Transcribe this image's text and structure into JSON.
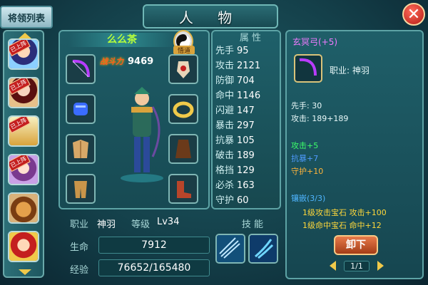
{
  "header": {
    "title": "人 物",
    "list_tab": "将领列表",
    "close_symbol": "✕"
  },
  "roster": {
    "items": [
      {
        "locked": true,
        "locked_label": "已上阵"
      },
      {
        "locked": true,
        "locked_label": "已上阵"
      },
      {
        "locked": true,
        "locked_label": "已上阵"
      },
      {
        "locked": true,
        "locked_label": "已上阵"
      },
      {
        "locked": false,
        "locked_label": ""
      },
      {
        "locked": false,
        "locked_label": ""
      }
    ]
  },
  "hero": {
    "name": "么么茶",
    "seal_label": "悟道",
    "power_label": "战斗力",
    "power_value": "9469",
    "profession_label": "职业",
    "profession_value": "神羽",
    "level_label": "等级",
    "level_value": "Lv34",
    "hp_label": "生命",
    "hp_value": "7912",
    "exp_label": "经验",
    "exp_value": "76652/165480"
  },
  "attributes": {
    "title": "属 性",
    "rows": [
      {
        "k": "先手",
        "v": "95"
      },
      {
        "k": "攻击",
        "v": "2121"
      },
      {
        "k": "防御",
        "v": "704"
      },
      {
        "k": "命中",
        "v": "1146"
      },
      {
        "k": "闪避",
        "v": "147"
      },
      {
        "k": "暴击",
        "v": "297"
      },
      {
        "k": "抗暴",
        "v": "105"
      },
      {
        "k": "破击",
        "v": "189"
      },
      {
        "k": "格挡",
        "v": "129"
      },
      {
        "k": "必杀",
        "v": "163"
      },
      {
        "k": "守护",
        "v": "60"
      }
    ]
  },
  "skills": {
    "title": "技 能"
  },
  "detail": {
    "item_name": "玄冥弓(+5)",
    "job_line": "职业: 神羽",
    "speed_line": "先手:    30",
    "attack_line": "攻击:    189+189",
    "bonuses": [
      {
        "text": "攻击+5",
        "color": "#3dff6a"
      },
      {
        "text": "抗暴+7",
        "color": "#4f9bff"
      },
      {
        "text": "守护+10",
        "color": "#ffb43a"
      }
    ],
    "gem_title": "镶嵌(3/3)",
    "gems": [
      "1级攻击宝石 攻击+100",
      "1级命中宝石 命中+12"
    ],
    "unequip_label": "卸下",
    "page": "1/1"
  }
}
